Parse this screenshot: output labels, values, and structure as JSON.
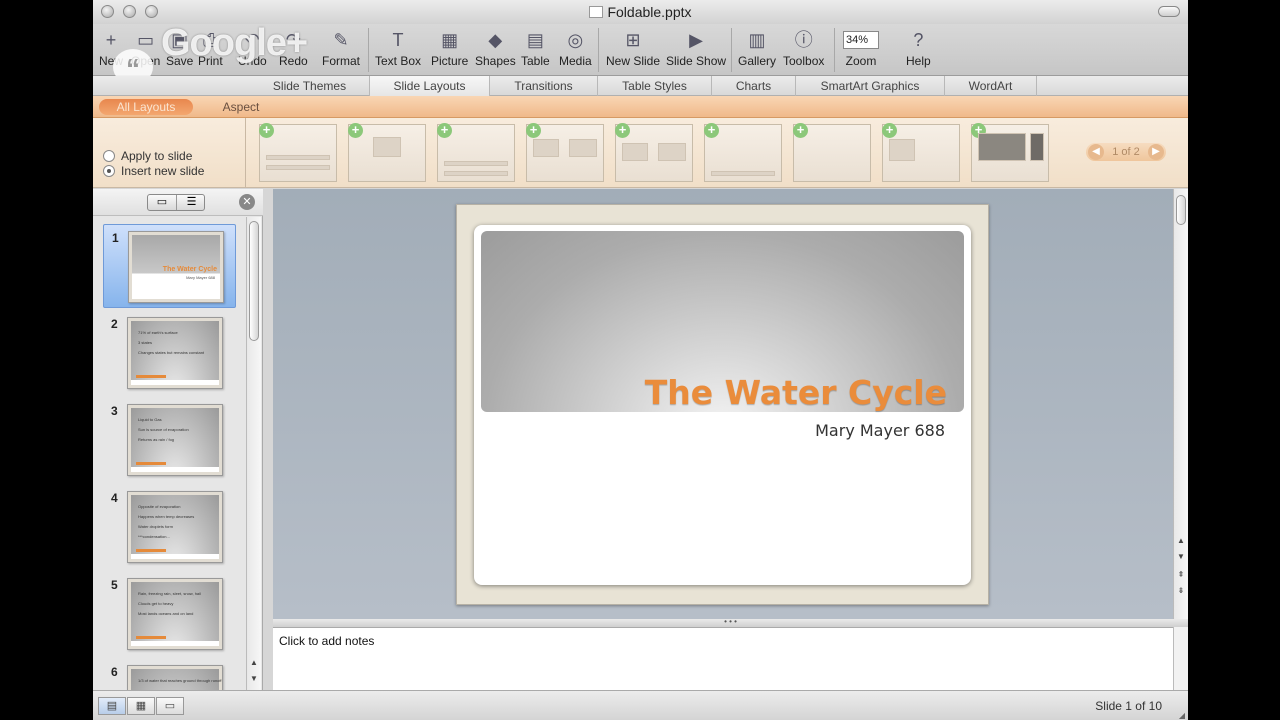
{
  "window": {
    "title": "Foldable.pptx"
  },
  "toolbar": {
    "new": "New",
    "open": "Open",
    "save": "Save",
    "print": "Print",
    "undo": "Undo",
    "redo": "Redo",
    "format": "Format",
    "textbox": "Text Box",
    "picture": "Picture",
    "shapes": "Shapes",
    "table": "Table",
    "media": "Media",
    "newslide": "New Slide",
    "slideshow": "Slide Show",
    "gallery": "Gallery",
    "toolbox": "Toolbox",
    "zoom_label": "Zoom",
    "zoom_value": "34%",
    "help": "Help"
  },
  "overlay": {
    "text": "Google+"
  },
  "ribbon": {
    "tabs": [
      "Slide Themes",
      "Slide Layouts",
      "Transitions",
      "Table Styles",
      "Charts",
      "SmartArt Graphics",
      "WordArt"
    ],
    "subtabs": [
      "All Layouts",
      "Aspect"
    ],
    "options": [
      "Apply to slide",
      "Insert new slide"
    ],
    "pager": "1 of 2"
  },
  "slides": [
    {
      "num": "1",
      "title": "The Water Cycle",
      "subtitle": "Mary Mayer 688"
    },
    {
      "num": "2",
      "lines": [
        "71% of earth's surface",
        "3 states",
        "Changes states but remains constant"
      ]
    },
    {
      "num": "3",
      "lines": [
        "Liquid to Gas",
        "Sun is source of evaporation",
        "Returns as rain / fog"
      ]
    },
    {
      "num": "4",
      "lines": [
        "Opposite of evaporation",
        "Happens when temp decreases",
        "Water droplets form",
        "***condensation..."
      ]
    },
    {
      "num": "5",
      "lines": [
        "Rain, freezing rain, sleet, snow, hail",
        "Clouds get to heavy",
        "Most lands oceans and on land"
      ]
    },
    {
      "num": "6",
      "lines": [
        "1/3 of water that reaches ground through runoff"
      ]
    }
  ],
  "current_slide": {
    "title": "The Water Cycle",
    "subtitle": "Mary Mayer 688"
  },
  "notes": {
    "placeholder": "Click to add notes"
  },
  "status": {
    "slide_count": "Slide 1 of 10"
  },
  "colors": {
    "accent": "#ea8c3b",
    "selection": "#86b4ec",
    "ribbon_orange": "#f0b98a"
  }
}
